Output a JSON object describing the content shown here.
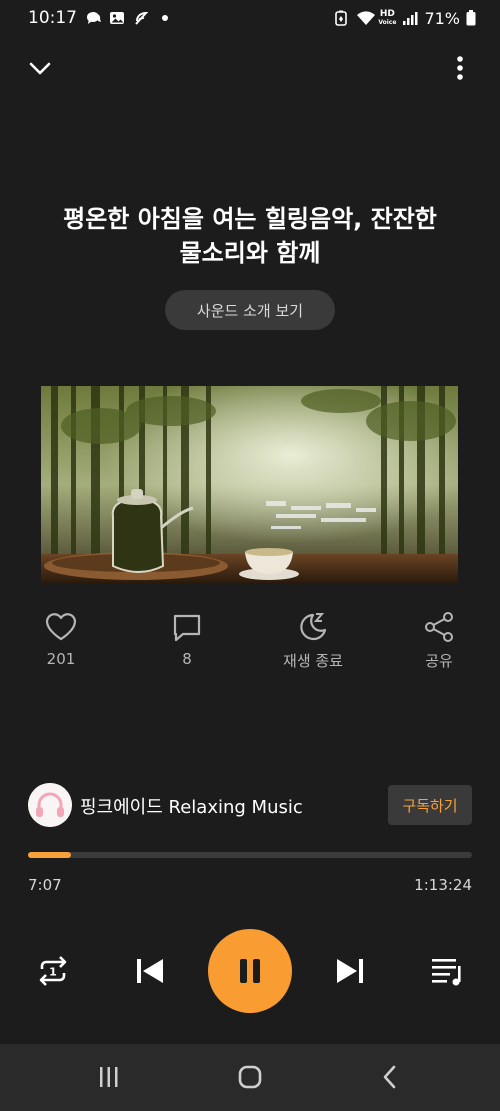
{
  "status_bar": {
    "time": "10:17",
    "battery": "71%",
    "hd_label": "HD",
    "voice_label": "Voice",
    "icons": [
      "chat-bubble-icon",
      "gallery-icon",
      "feather-icon",
      "dot-icon",
      "battery-saver-icon",
      "wifi-icon",
      "signal-icon",
      "battery-icon"
    ]
  },
  "top_bar": {
    "collapse_icon": "chevron-down-icon",
    "more_icon": "more-vertical-icon"
  },
  "track": {
    "title_line1": "평온한 아침을 여는 힐링음악, 잔잔한",
    "title_line2": "물소리와 함께",
    "intro_button": "사운드 소개 보기"
  },
  "actions": {
    "like": {
      "icon": "heart-icon",
      "label": "201"
    },
    "comment": {
      "icon": "comment-icon",
      "label": "8"
    },
    "sleep_timer": {
      "icon": "moon-icon",
      "label": "재생 종료"
    },
    "share": {
      "icon": "share-icon",
      "label": "공유"
    }
  },
  "channel": {
    "name": "핑크에이드 Relaxing Music",
    "avatar_icon": "headphones-icon",
    "subscribe_label": "구독하기"
  },
  "playback": {
    "elapsed": "7:07",
    "total": "1:13:24",
    "progress_fraction": 0.097
  },
  "controls": {
    "repeat_icon": "repeat-one-icon",
    "repeat_badge": "1",
    "previous_icon": "skip-previous-icon",
    "pause_icon": "pause-icon",
    "next_icon": "skip-next-icon",
    "playlist_icon": "playlist-icon"
  },
  "nav_bar": {
    "recents_icon": "recents-icon",
    "home_icon": "home-icon",
    "back_icon": "back-icon"
  },
  "colors": {
    "background": "#1c1c1c",
    "accent": "#f99d33",
    "button_bg": "#3a3a3a",
    "muted_text": "#b5b5b5"
  }
}
